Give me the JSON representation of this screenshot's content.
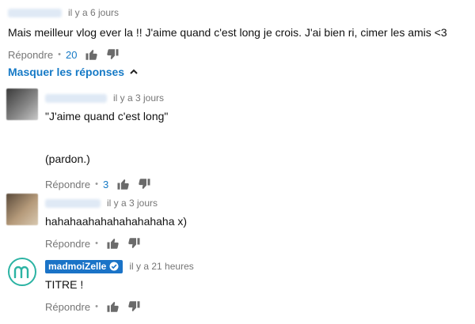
{
  "comments": [
    {
      "timestamp": "il y a 6 jours",
      "text": "Mais meilleur vlog ever la !! J'aime quand c'est long je crois. J'ai bien ri, cimer les amis <3",
      "reply_label": "Répondre",
      "likes": "20"
    }
  ],
  "toggle_replies_label": "Masquer les réponses",
  "replies": [
    {
      "timestamp": "il y a 3 jours",
      "text": "\"J'aime quand c'est long\"\n\n\n(pardon.)",
      "reply_label": "Répondre",
      "likes": "3"
    },
    {
      "timestamp": "il y a 3 jours",
      "text": "hahahaahahahahahahaha x)",
      "reply_label": "Répondre",
      "likes": ""
    },
    {
      "author": "madmoiZelle",
      "timestamp": "il y a 21 heures",
      "text": "TITRE !",
      "reply_label": "Répondre",
      "likes": ""
    }
  ],
  "colors": {
    "link_blue": "#167ac6",
    "badge_blue": "#1a73c7",
    "meta_gray": "#767676",
    "avatar_teal": "#2bb3a3"
  },
  "icons": {
    "like": "thumbs-up-icon",
    "dislike": "thumbs-down-icon",
    "collapse": "chevron-up-icon",
    "verified": "checkmark-icon",
    "brand_avatar": "madmoizelle-m-logo-icon"
  }
}
